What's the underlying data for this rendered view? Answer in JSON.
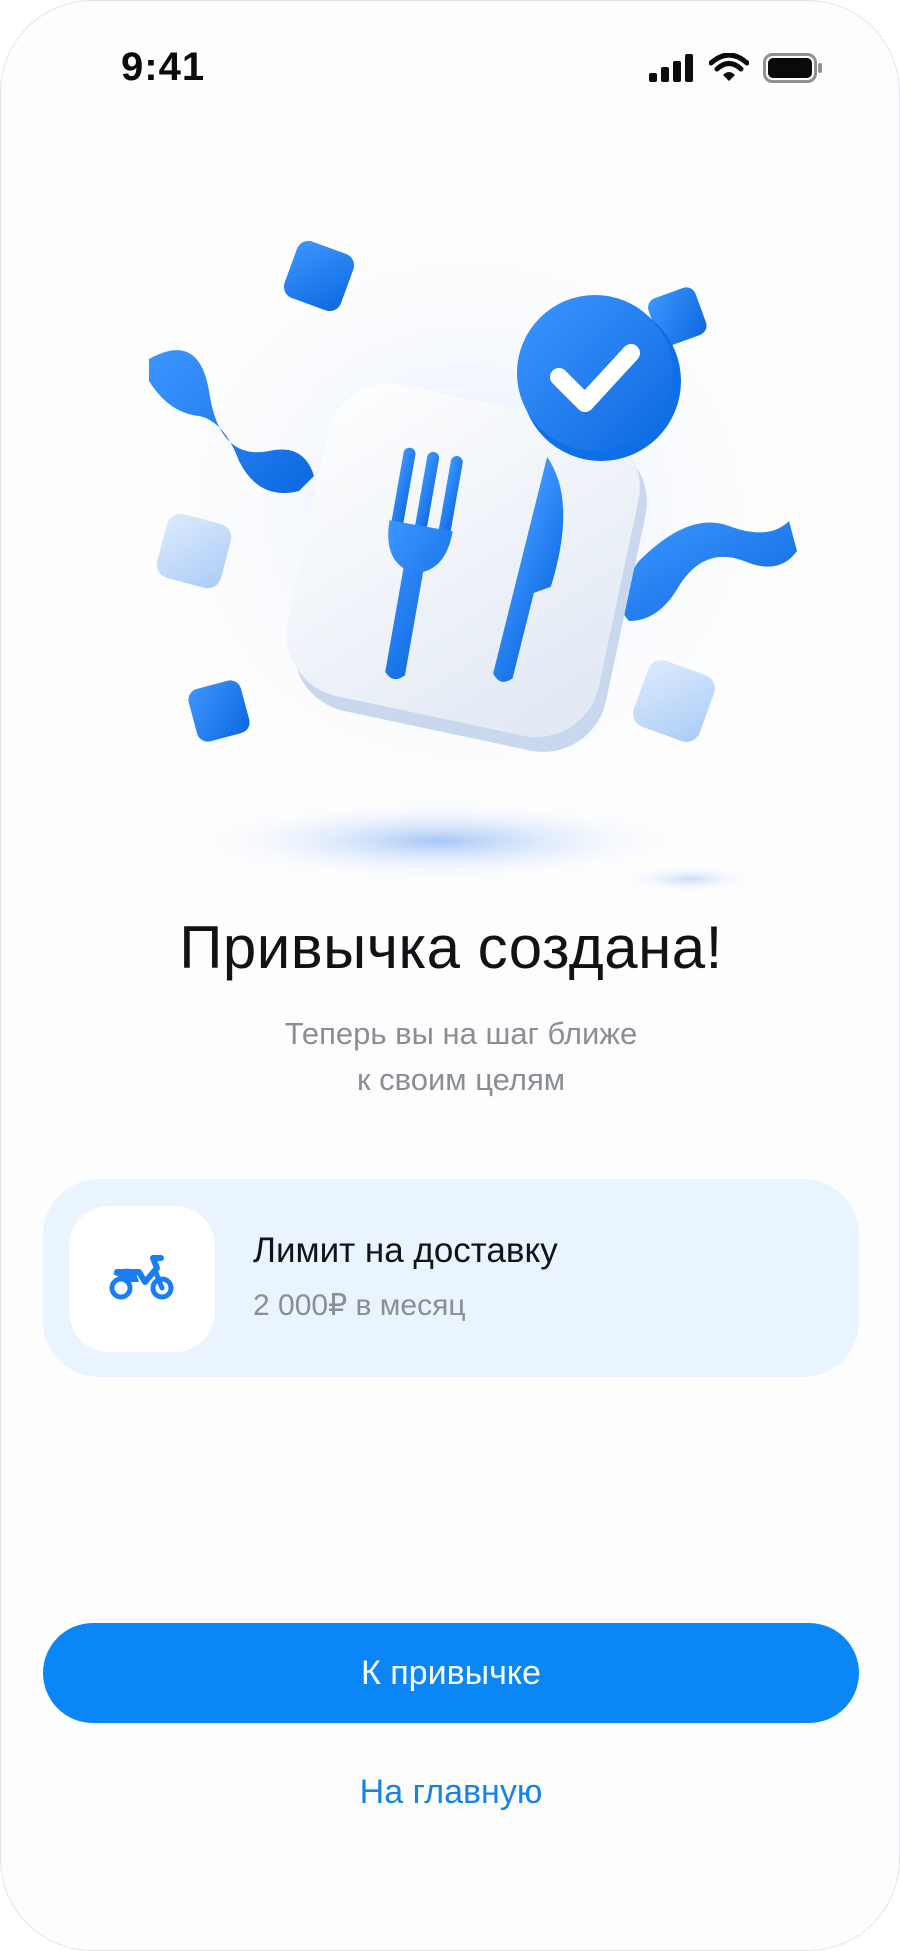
{
  "status_bar": {
    "time": "9:41",
    "icons": [
      "cellular-signal-icon",
      "wifi-icon",
      "battery-icon"
    ]
  },
  "hero": {
    "illustration": "fork-knife-checkmark-illustration",
    "colors": {
      "accent": "#1a7ef2",
      "tile": "#f2f6fb"
    }
  },
  "title": "Привычка создана!",
  "subtitle": {
    "line1": "Теперь вы на шаг ближе",
    "line2": "к своим целям"
  },
  "habit_card": {
    "icon": "motorcycle-icon",
    "title": "Лимит на доставку",
    "subtitle": "2 000₽ в месяц"
  },
  "actions": {
    "primary_label": "К привычке",
    "secondary_label": "На главную"
  },
  "colors": {
    "primary": "#0a86f6",
    "card_background": "#eaf4fe",
    "secondary_text": "#8a8e96"
  }
}
